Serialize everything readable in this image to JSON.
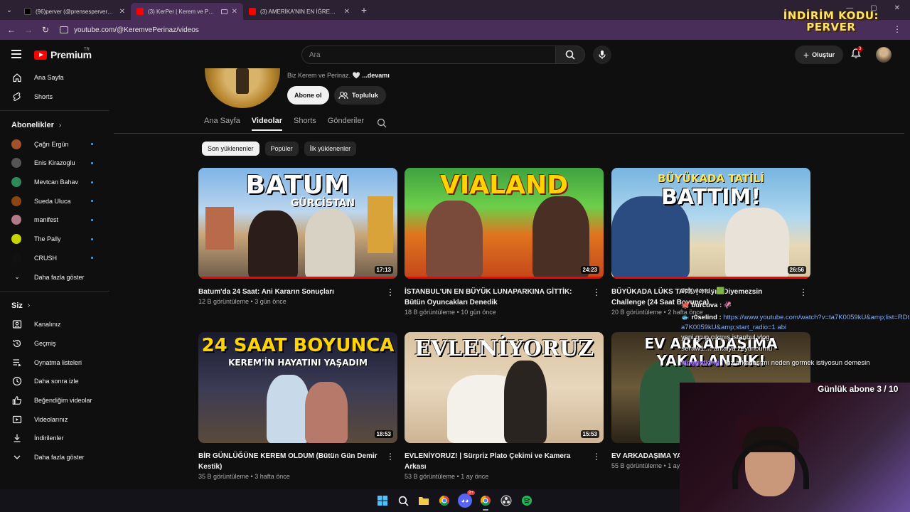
{
  "browser": {
    "tabs": [
      {
        "title": "(96)perver (@prensesperver) | T",
        "icon": "tiktok-icon",
        "active": false
      },
      {
        "title": "(3) KerPer | Kerem ve Perina",
        "icon": "youtube-icon",
        "active": true
      },
      {
        "title": "(3) AMERİKA'NIN EN İĞRENÇ F",
        "icon": "youtube-icon",
        "active": false
      }
    ],
    "url": "youtube.com/@KeremvePerinaz/videos"
  },
  "promo": {
    "line1": "İNDİRİM KODU:",
    "line2": "PERVER"
  },
  "header": {
    "logo_text": "Premium",
    "region": "TR",
    "search_placeholder": "Ara",
    "create_label": "Oluştur",
    "notifications": "3"
  },
  "sidebar": {
    "main": [
      {
        "label": "Ana Sayfa",
        "icon": "home-icon"
      },
      {
        "label": "Shorts",
        "icon": "shorts-icon"
      }
    ],
    "subs_header": "Abonelikler",
    "subscriptions": [
      {
        "label": "Çağrı Ergün",
        "color": "#a0522d"
      },
      {
        "label": "Enis Kirazoglu",
        "color": "#555555"
      },
      {
        "label": "Mevtcan Bahav",
        "color": "#2e8b57"
      },
      {
        "label": "Sueda Uluca",
        "color": "#8b4513"
      },
      {
        "label": "manifest",
        "color": "#b07a8a"
      },
      {
        "label": "The Pally",
        "color": "#c8d400"
      },
      {
        "label": "CRUSH",
        "color": "#111111"
      }
    ],
    "subs_more": "Daha fazla göster",
    "you_header": "Siz",
    "you_items": [
      {
        "label": "Kanalınız",
        "icon": "channel-icon"
      },
      {
        "label": "Geçmiş",
        "icon": "history-icon"
      },
      {
        "label": "Oynatma listeleri",
        "icon": "playlist-icon"
      },
      {
        "label": "Daha sonra izle",
        "icon": "clock-icon"
      },
      {
        "label": "Beğendiğim videolar",
        "icon": "like-icon"
      },
      {
        "label": "Videolarınız",
        "icon": "video-icon"
      },
      {
        "label": "İndirilenler",
        "icon": "download-icon"
      },
      {
        "label": "Daha fazla göster",
        "icon": "chevron-down-icon"
      }
    ]
  },
  "channel": {
    "description": "Biz Kerem ve Perinaz.",
    "heart": "🤍",
    "more": "...devamı",
    "subscribe_label": "Abone ol",
    "community_label": "Topluluk",
    "tabs": [
      "Ana Sayfa",
      "Videolar",
      "Shorts",
      "Gönderiler"
    ],
    "active_tab": "Videolar",
    "chips": [
      "Son yüklenenler",
      "Popüler",
      "İlk yüklenenler"
    ]
  },
  "videos": [
    {
      "title": "Batum'da 24 Saat: Ani Kararın Sonuçları",
      "views": "12 B görüntüleme",
      "age": "3 gün önce",
      "duration": "17:13",
      "thumb_text": "BATUM",
      "thumb_sub": "GÜRCİSTAN"
    },
    {
      "title": "İSTANBUL'UN EN BÜYÜK LUNAPARKINA GİTTİK: Bütün Oyuncakları Denedik",
      "views": "18 B görüntüleme",
      "age": "10 gün önce",
      "duration": "24:23",
      "thumb_text": "VIALAND",
      "thumb_sub": ""
    },
    {
      "title": "BÜYÜKADA LÜKS TATİL | 'Hayır' Diyemezsin Challenge (24 Saat Boyunca)",
      "views": "20 B görüntüleme",
      "age": "2 hafta önce",
      "duration": "26:56",
      "thumb_text": "BATTIM!",
      "thumb_sub": "BÜYÜKADA TATİLİ"
    },
    {
      "title": "BİR GÜNLÜĞÜNE KEREM OLDUM (Bütün Gün Demir Kestik)",
      "views": "35 B görüntüleme",
      "age": "3 hafta önce",
      "duration": "18:53",
      "thumb_text": "24 SAAT BOYUNCA",
      "thumb_sub": "KEREM'İN HAYATINI YAŞADIM"
    },
    {
      "title": "EVLENİYORUZ! | Sürpriz Plato Çekimi ve Kamera Arkası",
      "views": "53 B görüntüleme",
      "age": "1 ay önce",
      "duration": "15:53",
      "thumb_text": "EVLENİYORUZ",
      "thumb_sub": ""
    },
    {
      "title": "EV ARKADAŞIMA YA",
      "views": "55 B görüntüleme",
      "age": "1 ay",
      "duration": "",
      "thumb_text": "EV ARKADAŞIMA YAKALANDIK!",
      "thumb_sub": ""
    }
  ],
  "chat": [
    {
      "name": "JeXwend :",
      "color": "#cfcfcf",
      "msg": "",
      "badge": "🟩"
    },
    {
      "name": "burcuva :",
      "color": "#ffffff",
      "msg": "🦑",
      "badge": "🐙"
    },
    {
      "name": "r0selind :",
      "color": "#ffffff",
      "msg": "https://www.youtube.com/watch?v=ta7K0059kU&amp;list=RDta7K0059kU&amp;start_radio=1 abi",
      "badge": "🐟"
    },
    {
      "name": "seraw1...:",
      "color": "#cfcfcf",
      "msg": "antalya zeytinburnu",
      "badge": ""
    },
    {
      "name": "kinggofking :",
      "color": "#9b6bff",
      "msg": "kız arkadaşımı neden gormek istiyosun demesin",
      "badge": ""
    }
  ],
  "chat_misc": {
    "line_a": "yeni grup çıkmış",
    "line_b": "istanbul vlog"
  },
  "daily_sub": "Günlük abone 3 / 10",
  "taskbar": [
    "windows-icon",
    "search-icon",
    "folder-icon",
    "chrome-icon",
    "discord-icon",
    "chrome-icon",
    "obs-icon",
    "spotify-icon"
  ],
  "taskbar_badge": "9+"
}
